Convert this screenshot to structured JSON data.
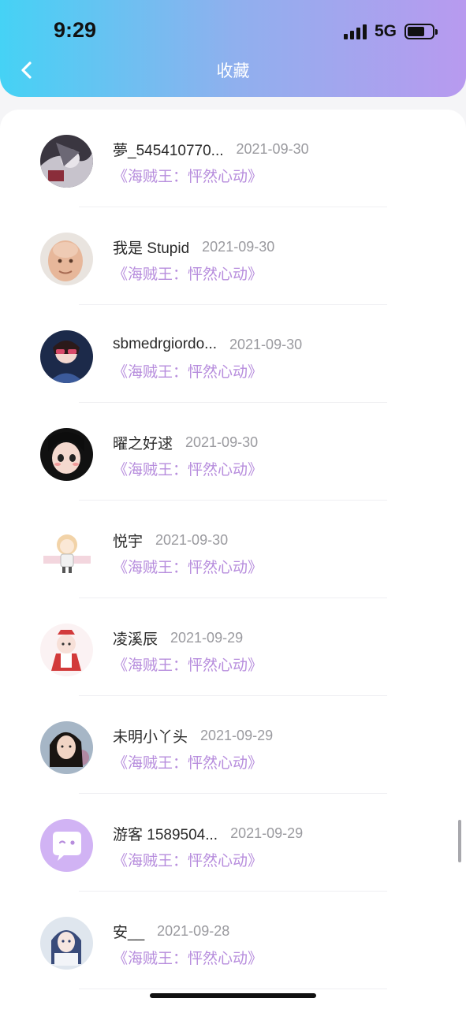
{
  "status": {
    "time": "9:29",
    "network": "5G"
  },
  "header": {
    "title": "收藏"
  },
  "colors": {
    "gradient_start": "#45d2f5",
    "gradient_end": "#b89aef",
    "work_title": "#b78ddd"
  },
  "favorites": [
    {
      "user": "夢_545410770...",
      "date": "2021-09-30",
      "work": "《海贼王：怦然心动》",
      "avatar_icon": "anime-avatar-icon"
    },
    {
      "user": "我是 Stupid",
      "date": "2021-09-30",
      "work": "《海贼王：怦然心动》",
      "avatar_icon": "old-man-avatar-icon"
    },
    {
      "user": "sbmedrgiordo...",
      "date": "2021-09-30",
      "work": "《海贼王：怦然心动》",
      "avatar_icon": "girl-photo-avatar-icon"
    },
    {
      "user": "曜之好逑",
      "date": "2021-09-30",
      "work": "《海贼王：怦然心动》",
      "avatar_icon": "cartoon-girl-avatar-icon"
    },
    {
      "user": "悦宇",
      "date": "2021-09-30",
      "work": "《海贼王：怦然心动》",
      "avatar_icon": "chibi-avatar-icon"
    },
    {
      "user": "凌溪辰",
      "date": "2021-09-29",
      "work": "《海贼王：怦然心动》",
      "avatar_icon": "maid-chibi-avatar-icon"
    },
    {
      "user": "未明小丫头",
      "date": "2021-09-29",
      "work": "《海贼王：怦然心动》",
      "avatar_icon": "girl-portrait-avatar-icon"
    },
    {
      "user": "游客 1589504...",
      "date": "2021-09-29",
      "work": "《海贼王：怦然心动》",
      "avatar_icon": "default-chat-avatar-icon"
    },
    {
      "user": "安__",
      "date": "2021-09-28",
      "work": "《海贼王：怦然心动》",
      "avatar_icon": "anime-sketch-avatar-icon"
    }
  ]
}
